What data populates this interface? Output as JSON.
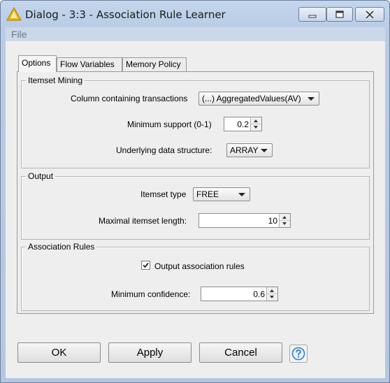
{
  "window": {
    "title": "Dialog - 3:3 - Association Rule Learner",
    "app_icon": "warning-triangle-icon",
    "controls": [
      "minimize-icon",
      "maximize-icon",
      "close-icon"
    ]
  },
  "menu": {
    "file": "File"
  },
  "tabs": [
    {
      "label": "Options",
      "active": true
    },
    {
      "label": "Flow Variables",
      "active": false
    },
    {
      "label": "Memory Policy",
      "active": false
    }
  ],
  "itemset_mining": {
    "title": "Itemset Mining",
    "column_label": "Column containing transactions",
    "column_value": "(...) AggregatedValues(AV)",
    "min_support_label": "Minimum support (0-1)",
    "min_support_value": "0.2",
    "structure_label": "Underlying data structure:",
    "structure_value": "ARRAY"
  },
  "output": {
    "title": "Output",
    "itemset_type_label": "Itemset type",
    "itemset_type_value": "FREE",
    "max_length_label": "Maximal itemset length:",
    "max_length_value": "10"
  },
  "association_rules": {
    "title": "Association Rules",
    "output_rules_label": "Output association rules",
    "output_rules_checked": true,
    "min_confidence_label": "Minimum confidence:",
    "min_confidence_value": "0.6"
  },
  "buttons": {
    "ok": "OK",
    "apply": "Apply",
    "cancel": "Cancel",
    "help_icon": "help-icon"
  },
  "colors": {
    "frame": "#b9cce6",
    "client": "#eeeeee",
    "help_accent": "#2f7fc9",
    "warning": "#f2b400"
  }
}
